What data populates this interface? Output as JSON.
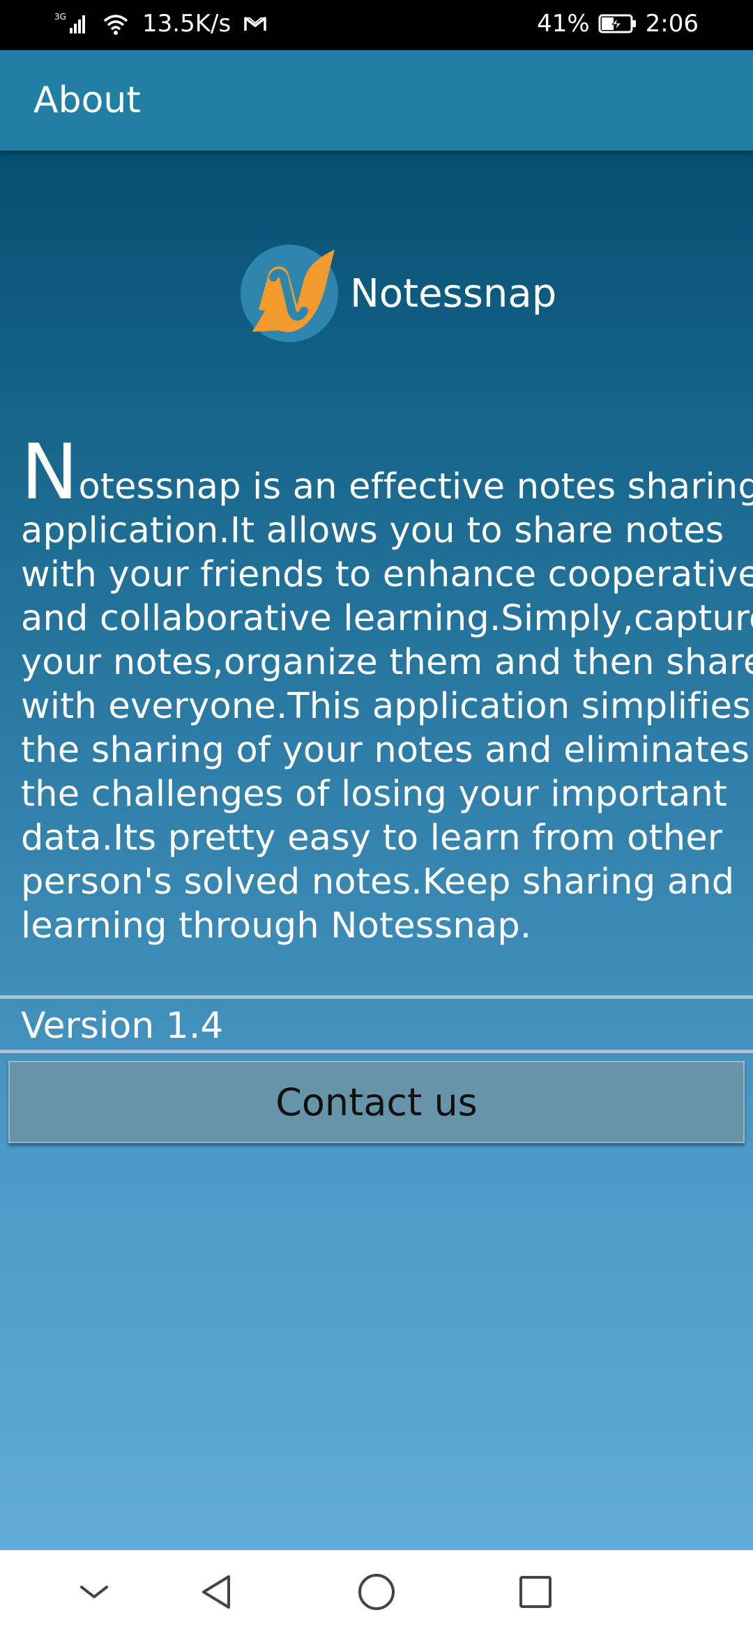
{
  "status_bar": {
    "network_type": "3G",
    "speed": "13.5K/s",
    "battery": "41%",
    "time": "2:06",
    "icons": [
      "signal-icon",
      "wifi-icon",
      "gmail-icon",
      "battery-charging-icon"
    ]
  },
  "app_bar": {
    "title": "About"
  },
  "logo": {
    "name": "Notessnap",
    "colors": {
      "blue": "#2f86ad",
      "orange": "#f29a2e"
    }
  },
  "description": {
    "drop_cap": "N",
    "first_line_rest": "otessnap is an effective notes sharing",
    "lines": [
      "application.It allows you to share notes",
      "with your friends to enhance cooperative",
      "and collaborative learning.Simply,capture",
      "your notes,organize them and then share",
      "with everyone.This application  simplifies",
      "the sharing of your notes and eliminates",
      "the challenges of losing your important",
      "data.Its pretty easy to learn from other",
      "person's solved notes.Keep sharing and",
      "learning through Notessnap."
    ]
  },
  "version": {
    "label": "Version 1.4"
  },
  "contact_button": {
    "label": "Contact us"
  },
  "nav_bar": {
    "items": [
      "chevron-down-icon",
      "back-icon",
      "home-icon",
      "recents-icon"
    ]
  },
  "colors": {
    "app_bar": "#217fa4",
    "content_top": "#045072",
    "content_bottom": "#61acd8",
    "button": "#6794a9"
  }
}
